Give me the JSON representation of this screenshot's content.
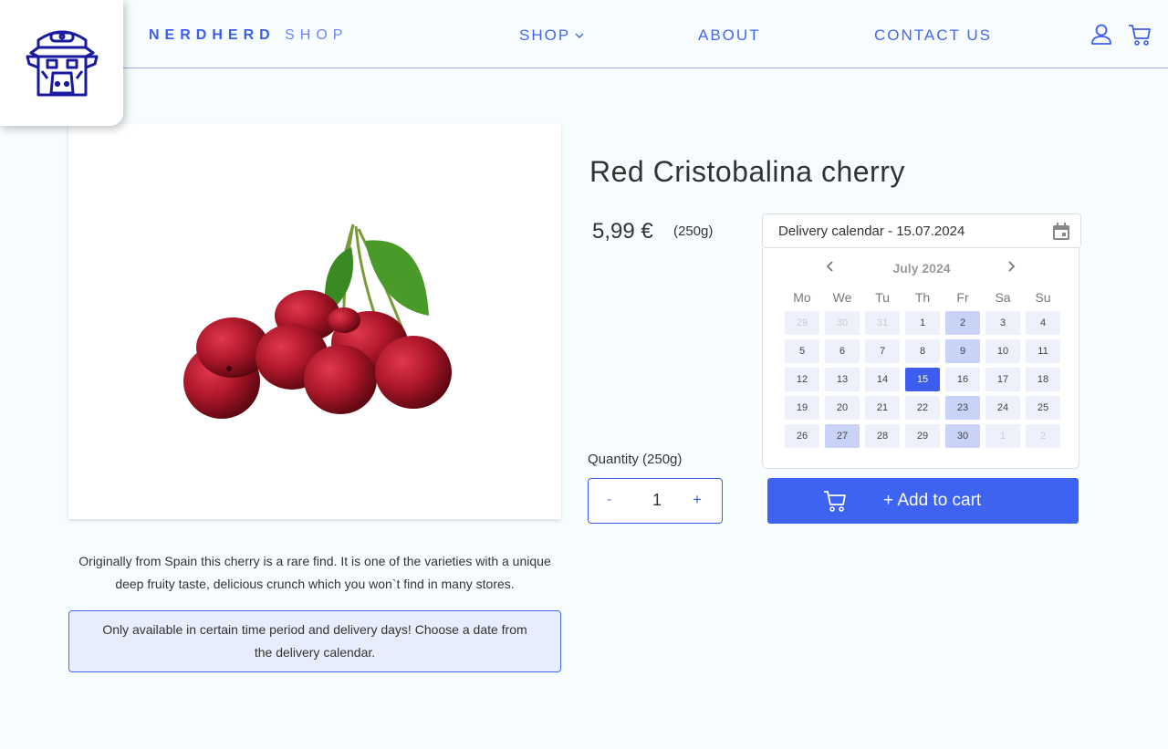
{
  "header": {
    "brand_bold": "NERDHERD",
    "brand_light": "SHOP",
    "nav": [
      {
        "label": "SHOP"
      },
      {
        "label": "ABOUT"
      },
      {
        "label": "CONTACT US"
      }
    ],
    "icons": [
      "user-icon",
      "cart-icon"
    ],
    "accent_color": "#3d5cf0"
  },
  "product": {
    "title": "Red Cristobalina cherry",
    "price": "5,99 €",
    "unit": "(250g)",
    "description": "Originally from Spain this cherry is a rare find. It is one of the varieties with a unique deep fruity taste, delicious crunch which you won`t find in many stores.",
    "notice": "Only available in certain time period and delivery days! Choose a date from the delivery calendar.",
    "quantity_label": "Quantity (250g)",
    "quantity_minus": "-",
    "quantity_value": "1",
    "quantity_plus": "+",
    "add_to_cart": "+ Add to cart"
  },
  "calendar": {
    "input_text": "Delivery calendar - 15.07.2024",
    "month": "July 2024",
    "weekdays": [
      "Mo",
      "We",
      "Tu",
      "Th",
      "Fr",
      "Sa",
      "Su"
    ],
    "weeks": [
      [
        {
          "d": "29",
          "s": "other"
        },
        {
          "d": "30",
          "s": "other"
        },
        {
          "d": "31",
          "s": "other"
        },
        {
          "d": "1",
          "s": ""
        },
        {
          "d": "2",
          "s": "avail"
        },
        {
          "d": "3",
          "s": ""
        },
        {
          "d": "4",
          "s": ""
        }
      ],
      [
        {
          "d": "5",
          "s": ""
        },
        {
          "d": "6",
          "s": ""
        },
        {
          "d": "7",
          "s": ""
        },
        {
          "d": "8",
          "s": ""
        },
        {
          "d": "9",
          "s": "avail"
        },
        {
          "d": "10",
          "s": ""
        },
        {
          "d": "11",
          "s": ""
        }
      ],
      [
        {
          "d": "12",
          "s": ""
        },
        {
          "d": "13",
          "s": ""
        },
        {
          "d": "14",
          "s": ""
        },
        {
          "d": "15",
          "s": "sel"
        },
        {
          "d": "16",
          "s": ""
        },
        {
          "d": "17",
          "s": ""
        },
        {
          "d": "18",
          "s": ""
        }
      ],
      [
        {
          "d": "19",
          "s": ""
        },
        {
          "d": "20",
          "s": ""
        },
        {
          "d": "21",
          "s": ""
        },
        {
          "d": "22",
          "s": ""
        },
        {
          "d": "23",
          "s": "avail"
        },
        {
          "d": "24",
          "s": ""
        },
        {
          "d": "25",
          "s": ""
        }
      ],
      [
        {
          "d": "26",
          "s": ""
        },
        {
          "d": "27",
          "s": "avail"
        },
        {
          "d": "28",
          "s": ""
        },
        {
          "d": "29",
          "s": ""
        },
        {
          "d": "30",
          "s": "avail"
        },
        {
          "d": "1",
          "s": "other"
        },
        {
          "d": "2",
          "s": "other"
        }
      ]
    ]
  }
}
